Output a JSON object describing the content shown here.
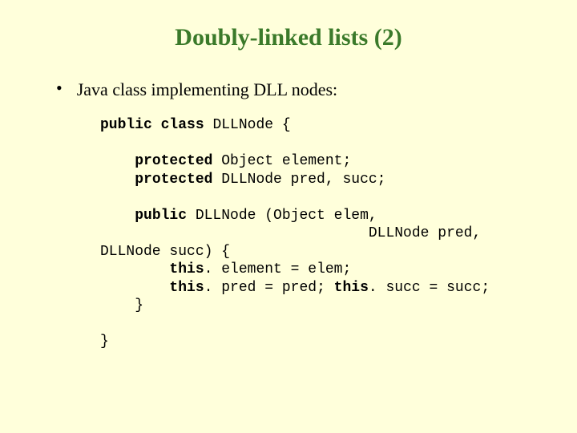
{
  "title": "Doubly-linked lists (2)",
  "bullet": {
    "marker": "•",
    "text": "Java class implementing DLL nodes:"
  },
  "code": {
    "kw_public": "public",
    "kw_class": "class",
    "kw_protected": "protected",
    "kw_this": "this",
    "l1_rest": " DLLNode {",
    "l2_rest": " Object element;",
    "l3_rest": " DLLNode pred, succ;",
    "l4_rest": " DLLNode (Object elem,",
    "l5": "                               DLLNode pred,",
    "l6": "DLLNode succ) {",
    "l7a": "        ",
    "l7b": ". element = elem;",
    "l8a": "        ",
    "l8b": ". pred = pred; ",
    "l8c": ". succ = succ;",
    "l9": "    }",
    "l10": "}"
  }
}
